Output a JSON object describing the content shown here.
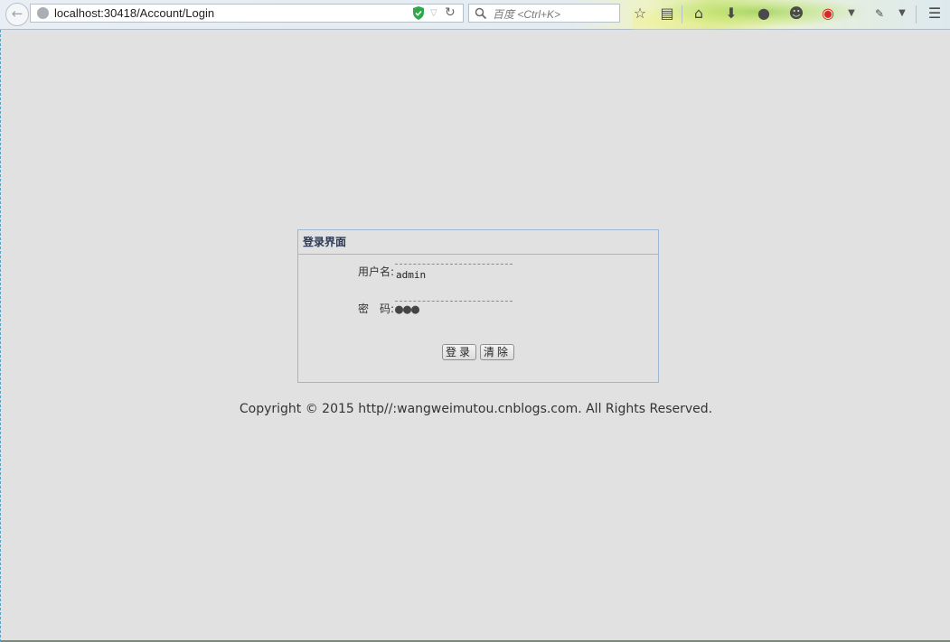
{
  "browser": {
    "url": "localhost:30418/Account/Login",
    "search_placeholder": "百度 <Ctrl+K>",
    "icons": {
      "back": "back-arrow-icon",
      "site": "globe-icon",
      "security": "shield-icon",
      "reload": "reload-icon",
      "search": "search-icon",
      "bookmark": "star-icon",
      "reading_list": "reading-list-icon",
      "home": "home-icon",
      "download": "download-icon",
      "chat": "chat-icon",
      "account": "person-icon",
      "weibo": "weibo-icon",
      "menu": "hamburger-menu-icon"
    }
  },
  "login": {
    "title": "登录界面",
    "username_label": "用户名:",
    "username_value": "admin",
    "password_label": "密　码:",
    "password_display": "●●●",
    "login_button": "登录",
    "clear_button": "清除"
  },
  "footer": {
    "copyright": "Copyright © 2015 http//:wangweimutou.cnblogs.com. All Rights Reserved."
  },
  "colors": {
    "page_background": "#e1e1e1",
    "panel_border": "#9cb6d6",
    "header_text": "#2d3a55",
    "shield_green": "#2ea84a"
  }
}
